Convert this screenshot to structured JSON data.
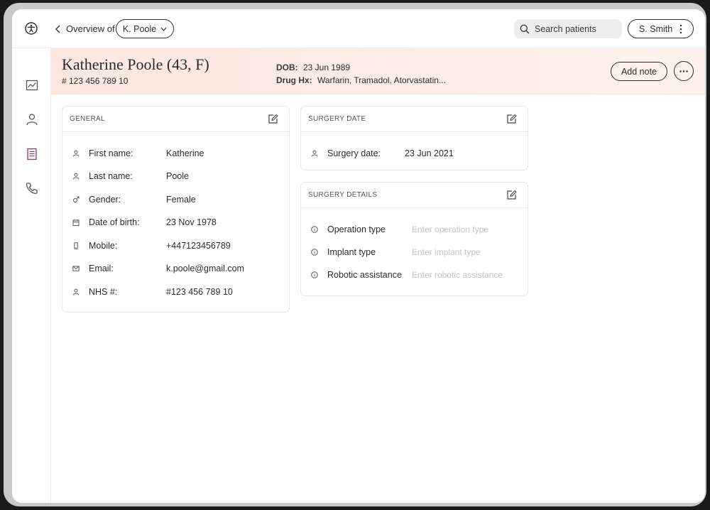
{
  "topbar": {
    "back_label": "Overview of",
    "patient_selector": "K. Poole",
    "search_placeholder": "Search patients",
    "user_label": "S. Smith"
  },
  "sidebar": {
    "items": [
      {
        "icon": "chart-icon"
      },
      {
        "icon": "person-icon"
      },
      {
        "icon": "document-icon"
      },
      {
        "icon": "phone-icon"
      }
    ]
  },
  "patient": {
    "name": "Katherine Poole (43,  F)",
    "nhs": "# 123 456 789 10",
    "dob_label": "DOB:",
    "dob": "23 Jun 1989",
    "drug_label": "Drug Hx:",
    "drugs": "Warfarin, Tramadol, Atorvastatin...",
    "add_note_label": "Add note"
  },
  "general": {
    "title": "GENERAL",
    "rows": [
      {
        "icon": "person-icon",
        "label": "First name:",
        "value": "Katherine"
      },
      {
        "icon": "person-icon",
        "label": "Last name:",
        "value": "Poole"
      },
      {
        "icon": "gender-icon",
        "label": "Gender:",
        "value": "Female"
      },
      {
        "icon": "calendar-icon",
        "label": "Date of birth:",
        "value": "23 Nov 1978"
      },
      {
        "icon": "mobile-icon",
        "label": "Mobile:",
        "value": "+447123456789"
      },
      {
        "icon": "mail-icon",
        "label": "Email:",
        "value": "k.poole@gmail.com"
      },
      {
        "icon": "person-icon",
        "label": "NHS #:",
        "value": "#123 456 789 10"
      }
    ]
  },
  "surgery_date": {
    "title": "SURGERY DATE",
    "label": "Surgery date:",
    "value": "23 Jun 2021"
  },
  "surgery_details": {
    "title": "SURGERY DETAILS",
    "rows": [
      {
        "label": "Operation type",
        "placeholder": "Enter operation type"
      },
      {
        "label": "Implant type",
        "placeholder": "Enter implant type"
      },
      {
        "label": "Robotic assistance",
        "placeholder": "Enter robotic assistance"
      }
    ]
  }
}
